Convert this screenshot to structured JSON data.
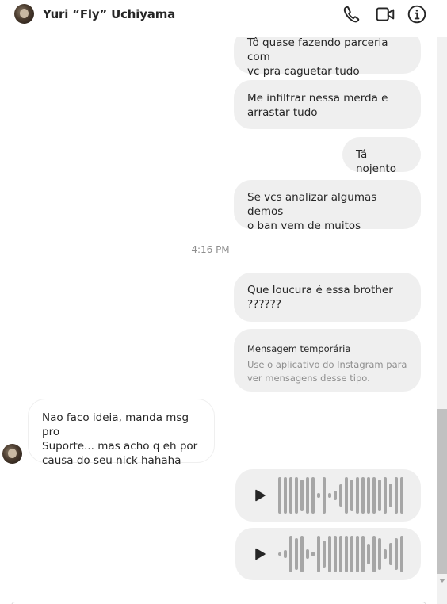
{
  "header": {
    "contact_name": "Yuri “Fly” Uchiyama",
    "icons": [
      "phone-icon",
      "video-icon",
      "info-icon"
    ]
  },
  "messages": [
    {
      "direction": "outgoing",
      "lines": [
        "Tô quase fazendo parceria com",
        "vc pra caguetar tudo"
      ]
    },
    {
      "direction": "outgoing",
      "lines": [
        "Me infiltrar nessa merda e",
        "arrastar tudo"
      ]
    },
    {
      "direction": "outgoing",
      "lines": [
        "Tá nojento"
      ]
    },
    {
      "direction": "outgoing",
      "lines": [
        "Se vcs analizar algumas demos",
        "o ban vem de muitos"
      ]
    }
  ],
  "timestamp": "4:16 PM",
  "messages_after": [
    {
      "direction": "outgoing",
      "lines": [
        "Que loucura é essa brother",
        "??????"
      ]
    }
  ],
  "temporary_message": {
    "title": "Mensagem temporária",
    "lines": [
      "Use o aplicativo do Instagram para",
      "ver mensagens desse tipo."
    ]
  },
  "incoming_message": {
    "lines": [
      "Nao faco ideia, manda msg pro",
      "Suporte... mas acho q eh por",
      "causa do seu nick hahaha"
    ]
  },
  "voice_messages": [
    {
      "icon": "play-icon"
    },
    {
      "icon": "play-icon"
    }
  ],
  "colors": {
    "bubble_outgoing": "#efefef",
    "text": "#262626",
    "muted": "#8e8e8e",
    "border": "#dbdbdb"
  }
}
